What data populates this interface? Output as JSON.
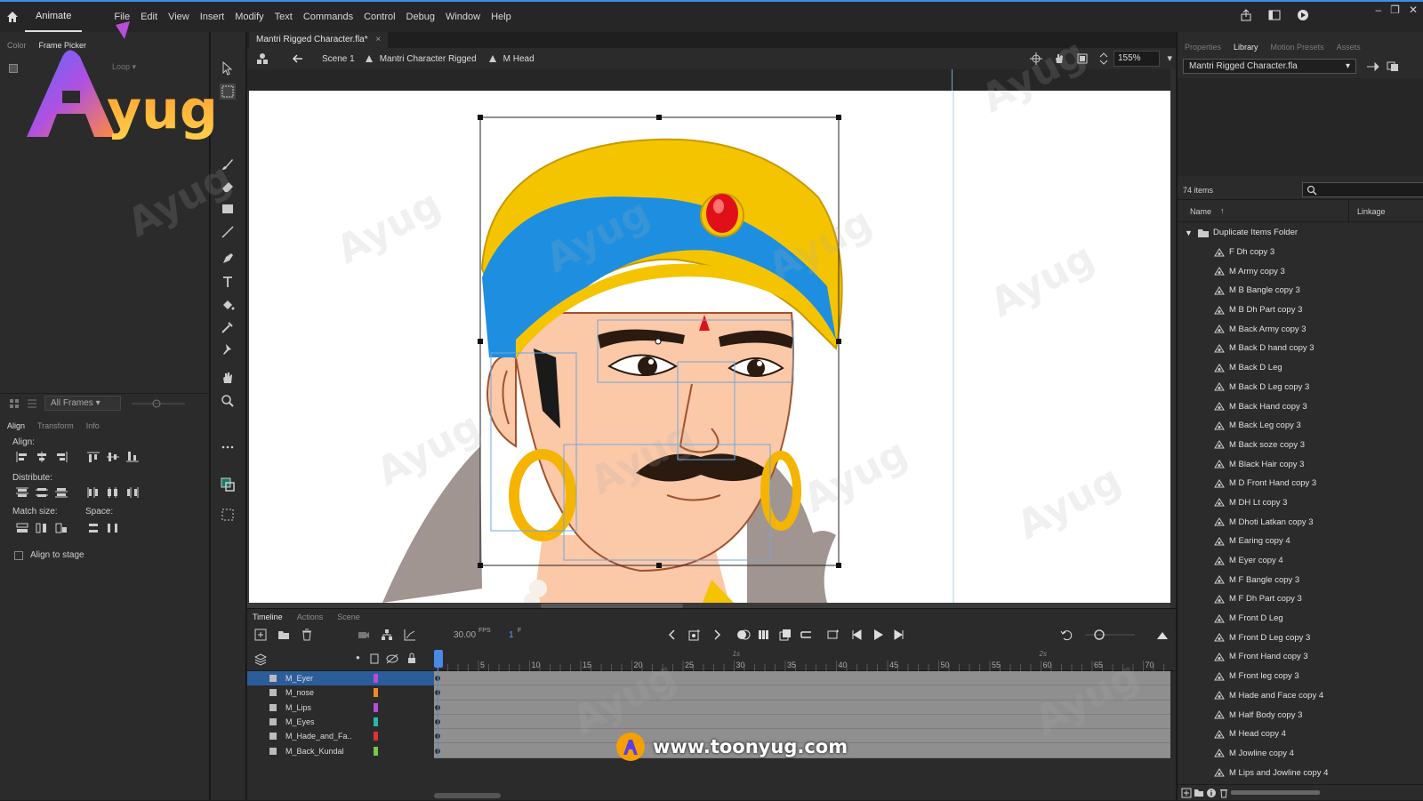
{
  "app": {
    "name": "Animate",
    "menu": [
      "File",
      "Edit",
      "View",
      "Insert",
      "Modify",
      "Text",
      "Commands",
      "Control",
      "Debug",
      "Window",
      "Help"
    ]
  },
  "left_panel": {
    "tabs": [
      "Color",
      "Frame Picker"
    ],
    "active_tab": "Frame Picker",
    "loop_label": "Loop",
    "frames_filter": "All Frames",
    "bottom_tabs": [
      "Align",
      "Transform",
      "Info"
    ],
    "align": {
      "align_label": "Align:",
      "distribute_label": "Distribute:",
      "match_size_label": "Match size:",
      "space_label": "Space:",
      "align_to_stage_label": "Align to stage"
    }
  },
  "document": {
    "tab_title": "Mantri Rigged Character.fla*",
    "breadcrumbs": [
      "Scene 1",
      "Mantri Character Rigged",
      "M Head"
    ],
    "zoom": "155%"
  },
  "timeline": {
    "tabs": [
      "Timeline",
      "Actions",
      "Scene"
    ],
    "fps_value": "30.00",
    "fps_unit": "FPS",
    "current_frame": "1",
    "frame_unit": "F",
    "ruler_ticks": [
      "5",
      "10",
      "15",
      "20",
      "25",
      "30",
      "35",
      "40",
      "45",
      "50",
      "55",
      "60",
      "65",
      "70"
    ],
    "ruler_seconds": [
      "1s",
      "2s"
    ],
    "layers": [
      {
        "name": "M_Eyer",
        "color": "#b84dd6",
        "selected": true
      },
      {
        "name": "M_nose",
        "color": "#f08a24",
        "selected": false
      },
      {
        "name": "M_Lips",
        "color": "#b84dd6",
        "selected": false
      },
      {
        "name": "M_Eyes",
        "color": "#28b8a8",
        "selected": false
      },
      {
        "name": "M_Hade_and_Fa..",
        "color": "#e33030",
        "selected": false
      },
      {
        "name": "M_Back_Kundal",
        "color": "#7ac943",
        "selected": false
      }
    ]
  },
  "right_panel": {
    "tabs": [
      "Properties",
      "Library",
      "Motion Presets",
      "Assets"
    ],
    "active_tab": "Library",
    "library_file": "Mantri Rigged Character.fla",
    "item_count": "74 items",
    "col_name": "Name",
    "col_linkage": "Linkage",
    "folder_name": "Duplicate Items Folder",
    "items": [
      "F Dh copy 3",
      "M Army copy 3",
      "M B Bangle copy 3",
      "M B Dh Part copy 3",
      "M Back Army copy 3",
      "M Back D hand copy 3",
      "M Back D Leg",
      "M Back D Leg copy 3",
      "M Back Hand copy 3",
      "M Back Leg copy 3",
      "M Back soze copy 3",
      "M Black Hair copy 3",
      "M D Front Hand copy 3",
      "M DH Lt copy 3",
      "M Dhoti Latkan copy 3",
      "M Earing copy 4",
      "M Eyer copy 4",
      "M F Bangle copy 3",
      "M F Dh Part copy 3",
      "M Front D Leg",
      "M Front D Leg copy 3",
      "M Front Hand copy 3",
      "M Front leg copy 3",
      "M Hade and Face copy 4",
      "M Half Body copy 3",
      "M Head copy 4",
      "M Jowline copy 4",
      "M Lips and Jowline copy 4"
    ]
  },
  "overlay": {
    "brand_logo_text": "Ayug",
    "website": "www.toonyug.com",
    "watermark_text": "Ayug"
  },
  "colors": {
    "selection_blue": "#2c5d9b",
    "accent": "#3a8ee6",
    "turban_yellow": "#f5c400",
    "turban_blue": "#1e8fe0",
    "skin": "#fbc8a8"
  }
}
